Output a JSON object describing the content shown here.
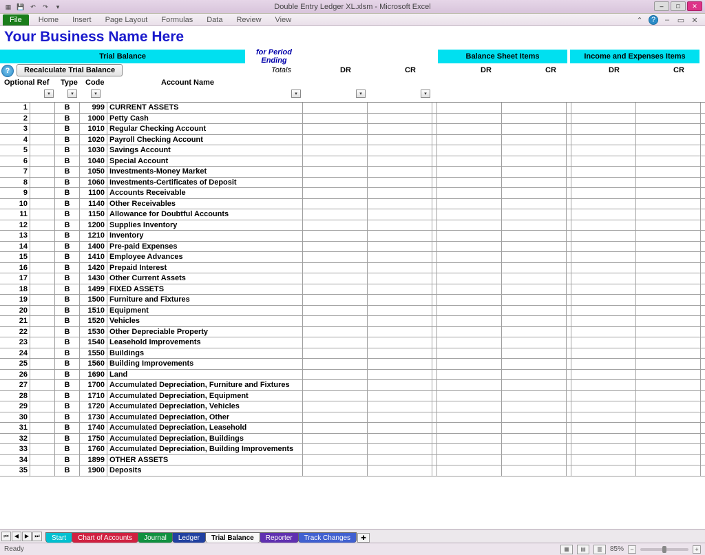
{
  "window": {
    "title": "Double Entry Ledger XL.xlsm - Microsoft Excel"
  },
  "ribbon": {
    "file": "File",
    "tabs": [
      "Home",
      "Insert",
      "Page Layout",
      "Formulas",
      "Data",
      "Review",
      "View"
    ]
  },
  "heading": "Your Business Name Here",
  "band": {
    "trial": "Trial Balance",
    "period": "for Period Ending",
    "bs": "Balance Sheet Items",
    "ie": "Income and Expenses Items"
  },
  "controls": {
    "recalc": "Recalculate Trial Balance",
    "totals": "Totals",
    "dr": "DR",
    "cr": "CR"
  },
  "colheads": {
    "ref": "Optional Ref",
    "type": "Type",
    "code": "Code",
    "acct": "Account Name"
  },
  "rows": [
    {
      "n": 1,
      "type": "B",
      "code": "999",
      "name": "CURRENT ASSETS"
    },
    {
      "n": 2,
      "type": "B",
      "code": "1000",
      "name": "Petty Cash"
    },
    {
      "n": 3,
      "type": "B",
      "code": "1010",
      "name": "Regular Checking Account"
    },
    {
      "n": 4,
      "type": "B",
      "code": "1020",
      "name": "Payroll Checking Account"
    },
    {
      "n": 5,
      "type": "B",
      "code": "1030",
      "name": "Savings Account"
    },
    {
      "n": 6,
      "type": "B",
      "code": "1040",
      "name": "Special Account"
    },
    {
      "n": 7,
      "type": "B",
      "code": "1050",
      "name": "Investments-Money Market"
    },
    {
      "n": 8,
      "type": "B",
      "code": "1060",
      "name": "Investments-Certificates of Deposit"
    },
    {
      "n": 9,
      "type": "B",
      "code": "1100",
      "name": "Accounts Receivable"
    },
    {
      "n": 10,
      "type": "B",
      "code": "1140",
      "name": "Other Receivables"
    },
    {
      "n": 11,
      "type": "B",
      "code": "1150",
      "name": "Allowance for Doubtful Accounts"
    },
    {
      "n": 12,
      "type": "B",
      "code": "1200",
      "name": "Supplies Inventory"
    },
    {
      "n": 13,
      "type": "B",
      "code": "1210",
      "name": "Inventory"
    },
    {
      "n": 14,
      "type": "B",
      "code": "1400",
      "name": "Pre-paid Expenses"
    },
    {
      "n": 15,
      "type": "B",
      "code": "1410",
      "name": "Employee Advances"
    },
    {
      "n": 16,
      "type": "B",
      "code": "1420",
      "name": "Prepaid Interest"
    },
    {
      "n": 17,
      "type": "B",
      "code": "1430",
      "name": "Other Current Assets"
    },
    {
      "n": 18,
      "type": "B",
      "code": "1499",
      "name": "FIXED ASSETS"
    },
    {
      "n": 19,
      "type": "B",
      "code": "1500",
      "name": "Furniture and Fixtures"
    },
    {
      "n": 20,
      "type": "B",
      "code": "1510",
      "name": "Equipment"
    },
    {
      "n": 21,
      "type": "B",
      "code": "1520",
      "name": "Vehicles"
    },
    {
      "n": 22,
      "type": "B",
      "code": "1530",
      "name": "Other Depreciable Property"
    },
    {
      "n": 23,
      "type": "B",
      "code": "1540",
      "name": "Leasehold Improvements"
    },
    {
      "n": 24,
      "type": "B",
      "code": "1550",
      "name": "Buildings"
    },
    {
      "n": 25,
      "type": "B",
      "code": "1560",
      "name": "Building Improvements"
    },
    {
      "n": 26,
      "type": "B",
      "code": "1690",
      "name": "Land"
    },
    {
      "n": 27,
      "type": "B",
      "code": "1700",
      "name": "Accumulated Depreciation, Furniture and Fixtures"
    },
    {
      "n": 28,
      "type": "B",
      "code": "1710",
      "name": "Accumulated Depreciation, Equipment"
    },
    {
      "n": 29,
      "type": "B",
      "code": "1720",
      "name": "Accumulated Depreciation, Vehicles"
    },
    {
      "n": 30,
      "type": "B",
      "code": "1730",
      "name": "Accumulated Depreciation, Other"
    },
    {
      "n": 31,
      "type": "B",
      "code": "1740",
      "name": "Accumulated Depreciation, Leasehold"
    },
    {
      "n": 32,
      "type": "B",
      "code": "1750",
      "name": "Accumulated Depreciation, Buildings"
    },
    {
      "n": 33,
      "type": "B",
      "code": "1760",
      "name": "Accumulated Depreciation, Building Improvements"
    },
    {
      "n": 34,
      "type": "B",
      "code": "1899",
      "name": "OTHER ASSETS"
    },
    {
      "n": 35,
      "type": "B",
      "code": "1900",
      "name": "Deposits"
    }
  ],
  "tabs": {
    "start": "Start",
    "coa": "Chart of Accounts",
    "journal": "Journal",
    "ledger": "Ledger",
    "trial": "Trial Balance",
    "reporter": "Reporter",
    "track": "Track Changes"
  },
  "status": {
    "ready": "Ready",
    "zoom": "85%"
  }
}
